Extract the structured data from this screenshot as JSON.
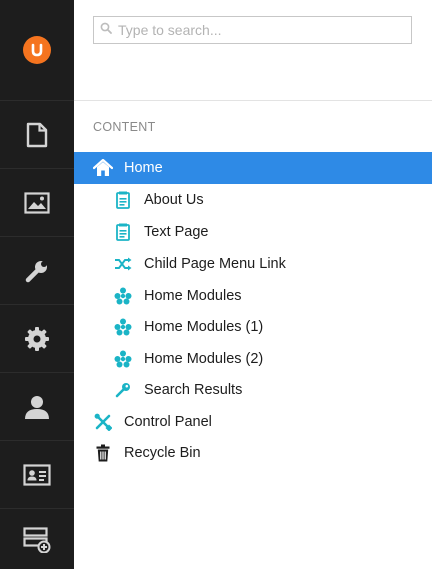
{
  "search": {
    "placeholder": "Type to search..."
  },
  "tree": {
    "header": "CONTENT",
    "nodes": [
      {
        "label": "Home",
        "icon": "home-icon",
        "active": true
      },
      {
        "label": "About Us",
        "icon": "document-icon"
      },
      {
        "label": "Text Page",
        "icon": "document-icon"
      },
      {
        "label": "Child Page Menu Link",
        "icon": "shuffle-icon"
      },
      {
        "label": "Home Modules",
        "icon": "modules-icon"
      },
      {
        "label": "Home Modules (1)",
        "icon": "modules-icon"
      },
      {
        "label": "Home Modules (2)",
        "icon": "modules-icon"
      },
      {
        "label": "Search Results",
        "icon": "key-icon"
      },
      {
        "label": "Control Panel",
        "icon": "tools-icon"
      },
      {
        "label": "Recycle Bin",
        "icon": "trash-icon"
      }
    ]
  },
  "sections": [
    "content-section-icon",
    "media-section-icon",
    "settings-section-icon",
    "developer-section-icon",
    "users-section-icon",
    "members-section-icon",
    "forms-section-icon"
  ],
  "colors": {
    "accent": "#2e8ae6",
    "node_icon": "#1bb4c6",
    "sidebar": "#1d1d1d",
    "logo": "#f5741f"
  }
}
